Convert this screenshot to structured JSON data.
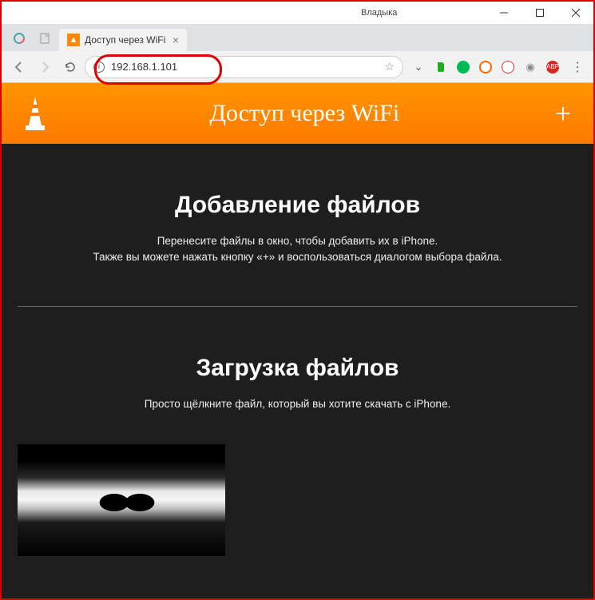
{
  "window": {
    "title": "Владыка"
  },
  "browser": {
    "tab_label": "Доступ через WiFi",
    "url": "192.168.1.101"
  },
  "page": {
    "header_title": "Доступ через WiFi",
    "sections": {
      "add": {
        "heading": "Добавление файлов",
        "line1": "Перенесите файлы в окно, чтобы добавить их в iPhone.",
        "line2": "Также вы можете нажать кнопку «+» и воспользоваться диалогом выбора файла."
      },
      "download": {
        "heading": "Загрузка файлов",
        "line1": "Просто щёлкните файл, который вы хотите скачать с iPhone."
      }
    }
  }
}
